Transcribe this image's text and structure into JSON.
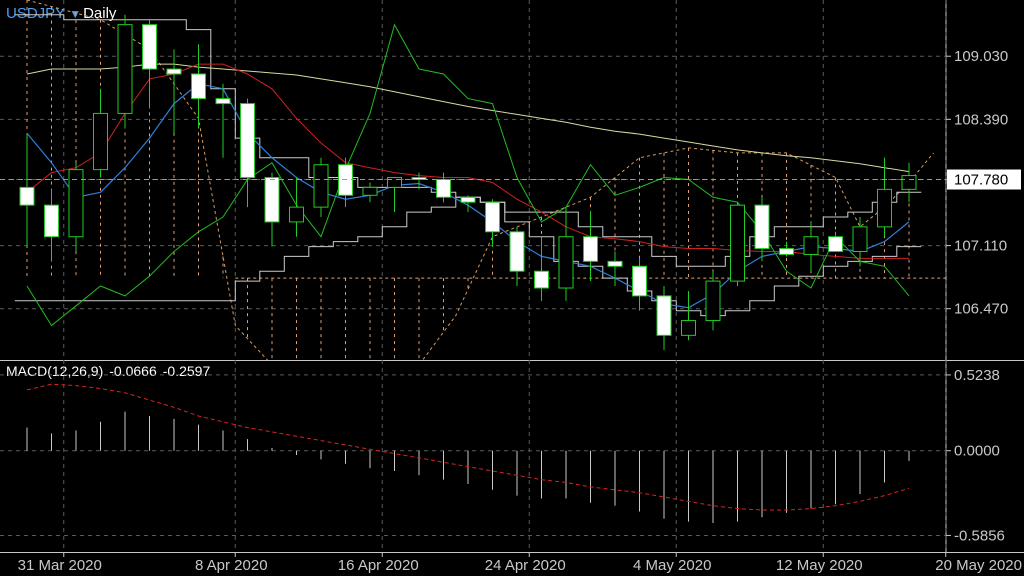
{
  "header": {
    "symbol": "USDJPY",
    "dropdown_icon": "triangle-down-icon",
    "timeframe": "Daily"
  },
  "macd_header": {
    "name": "MACD(12,26,9)",
    "main": "-0.0666",
    "signal": "-0.2597"
  },
  "colors": {
    "background": "#000000",
    "axis": "#c8c8c8",
    "grid": "#5a5a5a",
    "bull_body": "#000000",
    "bear_body": "#ffffff",
    "wick": "#22cc22",
    "tenkan": "#2f7fd8",
    "kijun": "#cc2222",
    "senkou_a": "#d49a60",
    "senkou_b": "#e0a070",
    "chikou": "#22bb22",
    "sma": "#d8d8a0",
    "donchian": "#cccccc",
    "price_tag_bg": "#ffffff",
    "price_tag_text": "#000000",
    "macd_hist": "#c8c8c8",
    "macd_signal": "#dd2222"
  },
  "chart_data": {
    "type": "candlestick",
    "price_axis_ticks": [
      "109.030",
      "108.390",
      "107.780",
      "107.110",
      "106.470"
    ],
    "price_axis_values": [
      109.03,
      108.39,
      107.78,
      107.11,
      106.47
    ],
    "current_price": "107.780",
    "macd_axis_ticks": [
      "0.5238",
      "0.0000",
      "-0.5856"
    ],
    "macd_axis_values": [
      0.5238,
      0.0,
      -0.5856
    ],
    "ylim_price": [
      105.95,
      109.6
    ],
    "ylim_macd": [
      -0.7,
      0.62
    ],
    "x_labels": [
      "31 Mar 2020",
      "8 Apr 2020",
      "16 Apr 2020",
      "24 Apr 2020",
      "4 May 2020",
      "12 May 2020",
      "20 May 2020"
    ],
    "x_label_bars": [
      1.5,
      8.5,
      14.5,
      20.5,
      26.5,
      32.5,
      37.5
    ],
    "candles": [
      {
        "o": 107.7,
        "h": 108.25,
        "l": 107.1,
        "c": 107.52
      },
      {
        "o": 107.52,
        "h": 107.68,
        "l": 106.95,
        "c": 107.2
      },
      {
        "o": 107.2,
        "h": 107.95,
        "l": 107.05,
        "c": 107.88
      },
      {
        "o": 107.88,
        "h": 108.7,
        "l": 107.8,
        "c": 108.45
      },
      {
        "o": 108.45,
        "h": 109.45,
        "l": 108.3,
        "c": 109.35
      },
      {
        "o": 109.35,
        "h": 109.4,
        "l": 108.5,
        "c": 108.9
      },
      {
        "o": 108.9,
        "h": 109.1,
        "l": 108.25,
        "c": 108.85
      },
      {
        "o": 108.85,
        "h": 109.15,
        "l": 108.3,
        "c": 108.6
      },
      {
        "o": 108.6,
        "h": 108.75,
        "l": 108.0,
        "c": 108.55
      },
      {
        "o": 108.55,
        "h": 108.6,
        "l": 107.5,
        "c": 107.8
      },
      {
        "o": 107.8,
        "h": 107.85,
        "l": 107.1,
        "c": 107.35
      },
      {
        "o": 107.35,
        "h": 107.8,
        "l": 107.2,
        "c": 107.5
      },
      {
        "o": 107.5,
        "h": 108.0,
        "l": 107.4,
        "c": 107.93
      },
      {
        "o": 107.93,
        "h": 108.0,
        "l": 107.5,
        "c": 107.62
      },
      {
        "o": 107.62,
        "h": 107.75,
        "l": 107.55,
        "c": 107.7
      },
      {
        "o": 107.7,
        "h": 107.8,
        "l": 107.45,
        "c": 107.8
      },
      {
        "o": 107.8,
        "h": 107.85,
        "l": 107.68,
        "c": 107.78
      },
      {
        "o": 107.78,
        "h": 107.85,
        "l": 107.55,
        "c": 107.6
      },
      {
        "o": 107.6,
        "h": 107.62,
        "l": 107.45,
        "c": 107.55
      },
      {
        "o": 107.55,
        "h": 107.58,
        "l": 107.1,
        "c": 107.25
      },
      {
        "o": 107.25,
        "h": 107.3,
        "l": 106.7,
        "c": 106.85
      },
      {
        "o": 106.85,
        "h": 107.2,
        "l": 106.55,
        "c": 106.68
      },
      {
        "o": 106.68,
        "h": 107.5,
        "l": 106.55,
        "c": 107.2
      },
      {
        "o": 107.2,
        "h": 107.45,
        "l": 106.75,
        "c": 106.95
      },
      {
        "o": 106.95,
        "h": 107.05,
        "l": 106.7,
        "c": 106.9
      },
      {
        "o": 106.9,
        "h": 106.98,
        "l": 106.45,
        "c": 106.6
      },
      {
        "o": 106.6,
        "h": 106.7,
        "l": 106.05,
        "c": 106.2
      },
      {
        "o": 106.2,
        "h": 106.65,
        "l": 106.15,
        "c": 106.35
      },
      {
        "o": 106.35,
        "h": 106.85,
        "l": 106.25,
        "c": 106.75
      },
      {
        "o": 106.75,
        "h": 107.55,
        "l": 106.7,
        "c": 107.52
      },
      {
        "o": 107.52,
        "h": 107.6,
        "l": 106.95,
        "c": 107.08
      },
      {
        "o": 107.08,
        "h": 107.15,
        "l": 107.0,
        "c": 107.02
      },
      {
        "o": 107.02,
        "h": 107.35,
        "l": 106.85,
        "c": 107.2
      },
      {
        "o": 107.2,
        "h": 107.25,
        "l": 107.05,
        "c": 107.05
      },
      {
        "o": 107.05,
        "h": 107.4,
        "l": 106.9,
        "c": 107.3
      },
      {
        "o": 107.3,
        "h": 108.0,
        "l": 107.2,
        "c": 107.68
      },
      {
        "o": 107.68,
        "h": 107.95,
        "l": 107.55,
        "c": 107.82
      }
    ],
    "tenkan": [
      108.25,
      107.95,
      107.6,
      107.65,
      107.9,
      108.2,
      108.55,
      108.75,
      108.7,
      108.25,
      108.0,
      107.8,
      107.65,
      107.58,
      107.62,
      107.72,
      107.74,
      107.65,
      107.52,
      107.35,
      107.15,
      107.0,
      106.95,
      106.9,
      106.78,
      106.65,
      106.52,
      106.48,
      106.62,
      106.85,
      107.0,
      107.05,
      107.1,
      107.08,
      107.05,
      107.15,
      107.35
    ],
    "kijun": [
      107.65,
      107.85,
      107.9,
      108.05,
      108.45,
      108.8,
      108.85,
      108.95,
      108.95,
      108.85,
      108.7,
      108.4,
      108.15,
      107.95,
      107.9,
      107.85,
      107.82,
      107.8,
      107.8,
      107.75,
      107.58,
      107.45,
      107.3,
      107.2,
      107.18,
      107.15,
      107.1,
      107.08,
      107.08,
      107.06,
      107.05,
      107.05,
      107.02,
      107.0,
      106.98,
      106.98,
      106.98
    ],
    "sma": [
      108.85,
      108.9,
      108.9,
      108.9,
      108.92,
      108.95,
      108.95,
      108.92,
      108.9,
      108.88,
      108.86,
      108.84,
      108.8,
      108.76,
      108.72,
      108.67,
      108.62,
      108.57,
      108.52,
      108.48,
      108.44,
      108.4,
      108.36,
      108.31,
      108.27,
      108.24,
      108.2,
      108.16,
      108.12,
      108.08,
      108.05,
      108.02,
      108.0,
      107.97,
      107.94,
      107.9,
      107.86
    ],
    "chikou": [
      106.7,
      106.3,
      106.5,
      106.7,
      106.6,
      106.8,
      107.05,
      107.25,
      107.4,
      107.78,
      107.95,
      107.52,
      107.2,
      107.88,
      108.45,
      109.35,
      108.9,
      108.85,
      108.6,
      108.55,
      107.8,
      107.35,
      107.5,
      107.93,
      107.62,
      107.7,
      107.8,
      107.78,
      107.6,
      107.55,
      107.25,
      106.85,
      106.68,
      107.2,
      106.95,
      106.9,
      106.6
    ],
    "donchian_hi": [
      109.45,
      109.45,
      109.4,
      109.4,
      109.4,
      109.4,
      109.4,
      109.3,
      108.7,
      108.2,
      108.0,
      108.0,
      107.8,
      107.8,
      107.7,
      107.7,
      107.7,
      107.65,
      107.6,
      107.55,
      107.45,
      107.45,
      107.45,
      107.3,
      107.2,
      107.2,
      107.0,
      106.9,
      106.9,
      107.0,
      107.2,
      107.3,
      107.3,
      107.4,
      107.45,
      107.55,
      107.65
    ],
    "donchian_lo": [
      106.55,
      106.55,
      106.55,
      106.55,
      106.55,
      106.55,
      106.55,
      106.55,
      106.55,
      106.75,
      106.85,
      107.0,
      107.1,
      107.15,
      107.2,
      107.3,
      107.45,
      107.5,
      107.6,
      107.55,
      107.35,
      107.2,
      106.95,
      106.9,
      106.78,
      106.65,
      106.55,
      106.45,
      106.4,
      106.45,
      106.55,
      106.7,
      106.8,
      106.9,
      106.95,
      107.0,
      107.1
    ],
    "senkou_a_points": [
      [
        0,
        109.6
      ],
      [
        3,
        109.4
      ],
      [
        5,
        109.1
      ],
      [
        7,
        108.4
      ],
      [
        8.5,
        106.3
      ],
      [
        10,
        105.9
      ],
      [
        16,
        105.9
      ],
      [
        17.5,
        106.4
      ],
      [
        19,
        107.2
      ],
      [
        21,
        107.4
      ],
      [
        23,
        107.6
      ],
      [
        25,
        108.0
      ],
      [
        27,
        108.1
      ],
      [
        29,
        108.05
      ],
      [
        31,
        108.05
      ],
      [
        33,
        107.8
      ],
      [
        34,
        107.3
      ],
      [
        35,
        107.5
      ],
      [
        36,
        107.75
      ],
      [
        37,
        108.05
      ]
    ],
    "kumo_flat": 106.78,
    "kumo_top_right": 107.98,
    "macd_main": [
      0.16,
      0.12,
      0.14,
      0.2,
      0.27,
      0.24,
      0.22,
      0.18,
      0.14,
      0.08,
      0.02,
      -0.03,
      -0.06,
      -0.09,
      -0.12,
      -0.14,
      -0.17,
      -0.2,
      -0.23,
      -0.27,
      -0.31,
      -0.33,
      -0.33,
      -0.36,
      -0.38,
      -0.42,
      -0.47,
      -0.49,
      -0.5,
      -0.49,
      -0.46,
      -0.43,
      -0.4,
      -0.37,
      -0.3,
      -0.22,
      -0.07
    ],
    "macd_signal": [
      0.42,
      0.46,
      0.45,
      0.43,
      0.4,
      0.35,
      0.3,
      0.24,
      0.2,
      0.16,
      0.13,
      0.1,
      0.07,
      0.04,
      0.01,
      -0.02,
      -0.05,
      -0.08,
      -0.11,
      -0.14,
      -0.17,
      -0.2,
      -0.22,
      -0.25,
      -0.27,
      -0.29,
      -0.32,
      -0.35,
      -0.38,
      -0.4,
      -0.41,
      -0.41,
      -0.4,
      -0.38,
      -0.35,
      -0.31,
      -0.26
    ]
  }
}
